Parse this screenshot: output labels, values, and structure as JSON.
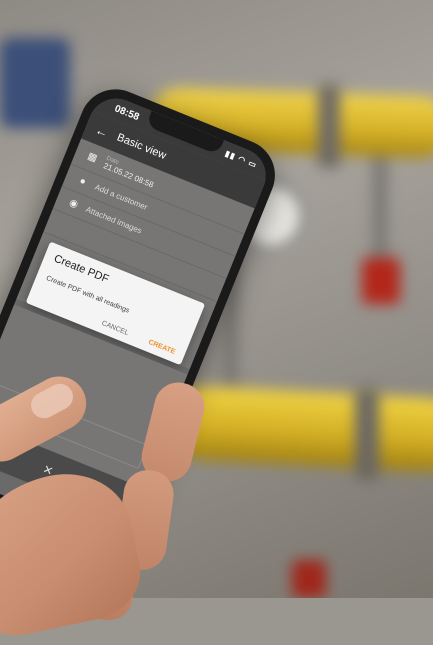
{
  "status_bar": {
    "time": "08:58",
    "icons": "▮▮ ◠ ▭"
  },
  "app_bar": {
    "back_icon": "back-arrow-icon",
    "title": "Basic view"
  },
  "rows": {
    "date": {
      "label": "Date",
      "value": "21.05.22 08:58"
    },
    "customer": {
      "text": "Add a customer"
    },
    "images": {
      "text": "Attached images"
    }
  },
  "dialog": {
    "title": "Create PDF",
    "option": "Create PDF with all readings",
    "cancel_label": "CANCEL",
    "create_label": "CREATE"
  },
  "colors": {
    "accent": "#f0902a",
    "app_bar": "#3a3a3a",
    "pipe": "#e3c233"
  }
}
